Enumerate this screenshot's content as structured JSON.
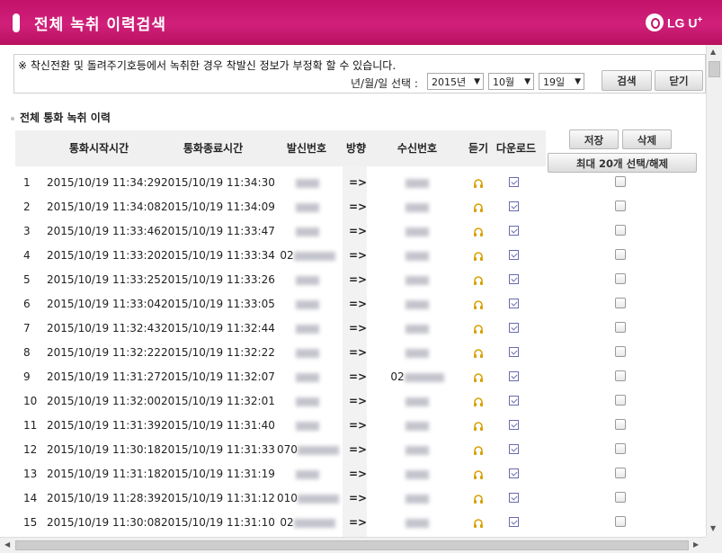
{
  "window": {
    "title": "전체 녹취 이력검색",
    "logo_text": "LG U",
    "logo_sup": "+"
  },
  "notice": "※ 착신전환 및 돌려주기호등에서 녹취한 경우 착발신 정보가 부정확 할 수 있습니다.",
  "date_filter": {
    "label": "년/월/일 선택 :",
    "year": "2015년",
    "month": "10월",
    "day": "19일",
    "search_label": "검색",
    "close_label": "닫기"
  },
  "section_title": "전체 통화 녹취 이력",
  "table": {
    "headers": {
      "start": "통화시작시간",
      "end": "통화종료시간",
      "caller": "발신번호",
      "direction": "방향",
      "receiver": "수신번호",
      "listen": "듣기",
      "download": "다운로드"
    },
    "save_label": "저장",
    "delete_label": "삭제",
    "select_max_label": "최대 20개 선택/해제",
    "rows": [
      {
        "num": "1",
        "start": "2015/10/19 11:34:29",
        "end": "2015/10/19 11:34:30",
        "caller_prefix": "",
        "receiver_prefix": "",
        "arrow": "=>"
      },
      {
        "num": "2",
        "start": "2015/10/19 11:34:08",
        "end": "2015/10/19 11:34:09",
        "caller_prefix": "",
        "receiver_prefix": "",
        "arrow": "=>"
      },
      {
        "num": "3",
        "start": "2015/10/19 11:33:46",
        "end": "2015/10/19 11:33:47",
        "caller_prefix": "",
        "receiver_prefix": "",
        "arrow": "=>"
      },
      {
        "num": "4",
        "start": "2015/10/19 11:33:20",
        "end": "2015/10/19 11:33:34",
        "caller_prefix": "02",
        "receiver_prefix": "",
        "arrow": "=>"
      },
      {
        "num": "5",
        "start": "2015/10/19 11:33:25",
        "end": "2015/10/19 11:33:26",
        "caller_prefix": "",
        "receiver_prefix": "",
        "arrow": "=>"
      },
      {
        "num": "6",
        "start": "2015/10/19 11:33:04",
        "end": "2015/10/19 11:33:05",
        "caller_prefix": "",
        "receiver_prefix": "",
        "arrow": "=>"
      },
      {
        "num": "7",
        "start": "2015/10/19 11:32:43",
        "end": "2015/10/19 11:32:44",
        "caller_prefix": "",
        "receiver_prefix": "",
        "arrow": "=>"
      },
      {
        "num": "8",
        "start": "2015/10/19 11:32:22",
        "end": "2015/10/19 11:32:22",
        "caller_prefix": "",
        "receiver_prefix": "",
        "arrow": "=>"
      },
      {
        "num": "9",
        "start": "2015/10/19 11:31:27",
        "end": "2015/10/19 11:32:07",
        "caller_prefix": "",
        "receiver_prefix": "02",
        "arrow": "=>"
      },
      {
        "num": "10",
        "start": "2015/10/19 11:32:00",
        "end": "2015/10/19 11:32:01",
        "caller_prefix": "",
        "receiver_prefix": "",
        "arrow": "=>"
      },
      {
        "num": "11",
        "start": "2015/10/19 11:31:39",
        "end": "2015/10/19 11:31:40",
        "caller_prefix": "",
        "receiver_prefix": "",
        "arrow": "=>"
      },
      {
        "num": "12",
        "start": "2015/10/19 11:30:18",
        "end": "2015/10/19 11:31:33",
        "caller_prefix": "070",
        "receiver_prefix": "",
        "arrow": "=>"
      },
      {
        "num": "13",
        "start": "2015/10/19 11:31:18",
        "end": "2015/10/19 11:31:19",
        "caller_prefix": "",
        "receiver_prefix": "",
        "arrow": "=>"
      },
      {
        "num": "14",
        "start": "2015/10/19 11:28:39",
        "end": "2015/10/19 11:31:12",
        "caller_prefix": "010",
        "receiver_prefix": "",
        "arrow": "=>"
      },
      {
        "num": "15",
        "start": "2015/10/19 11:30:08",
        "end": "2015/10/19 11:31:10",
        "caller_prefix": "02",
        "receiver_prefix": "",
        "arrow": "=>"
      }
    ]
  },
  "colors": {
    "titlebar": "#c2126a",
    "listen_icon": "#d8a000",
    "download_icon": "#6a6ab0"
  }
}
